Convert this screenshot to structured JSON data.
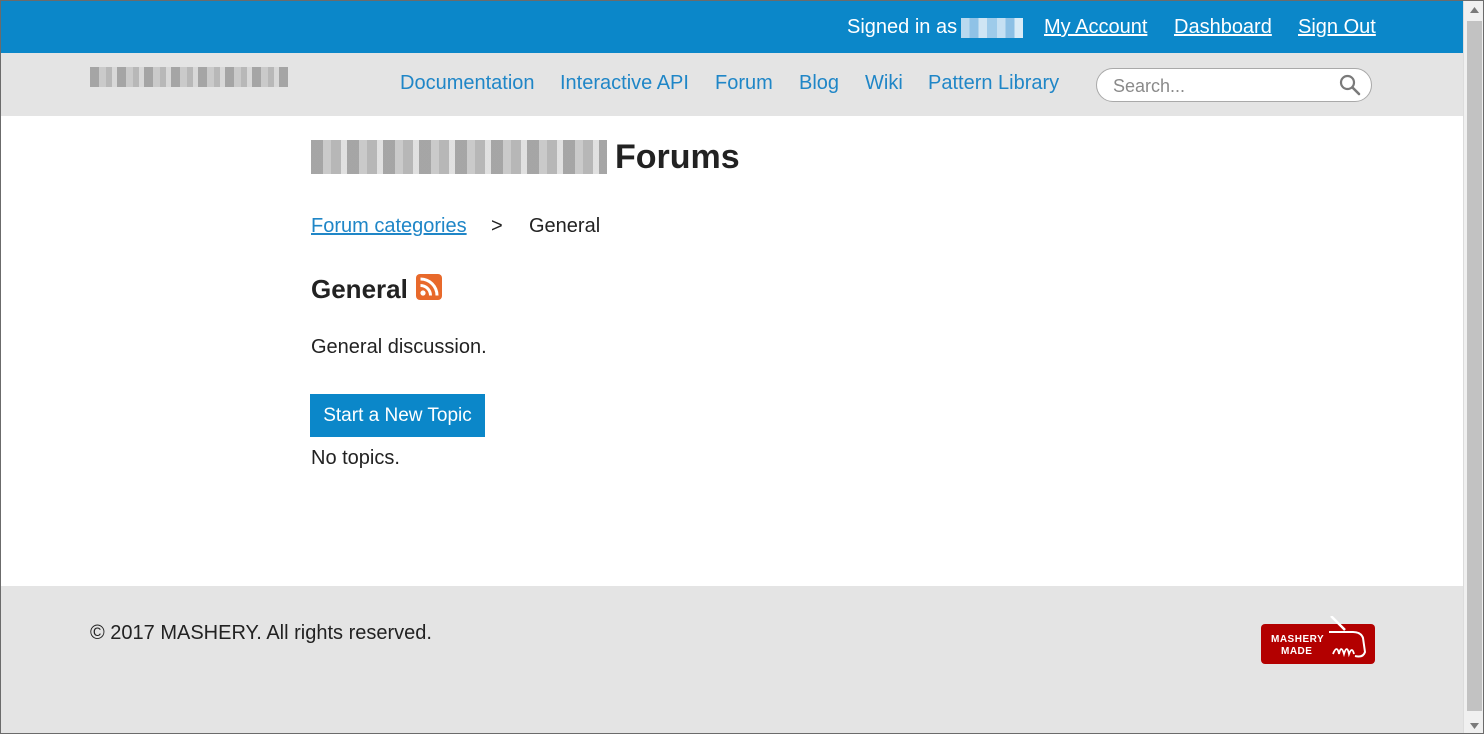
{
  "topbar": {
    "signed_in_label": "Signed in as",
    "my_account": "My Account",
    "dashboard": "Dashboard",
    "sign_out": "Sign Out"
  },
  "nav": {
    "items": [
      "Documentation",
      "Interactive API",
      "Forum",
      "Blog",
      "Wiki",
      "Pattern Library"
    ],
    "search_placeholder": "Search..."
  },
  "main": {
    "title_suffix": "Forums",
    "breadcrumb": {
      "parent": "Forum categories",
      "separator": ">",
      "current": "General"
    },
    "section_title": "General",
    "description": "General discussion.",
    "new_topic_button": "Start a New Topic",
    "empty_state": "No topics."
  },
  "footer": {
    "copyright": "© 2017 MASHERY. All rights reserved.",
    "badge_line1": "MASHERY",
    "badge_line2": "MADE"
  },
  "colors": {
    "brand_blue": "#0b87c9",
    "link_blue": "#1f86c7",
    "rss_orange": "#e8692b",
    "badge_red": "#b30000",
    "bar_gray": "#e4e4e4"
  }
}
